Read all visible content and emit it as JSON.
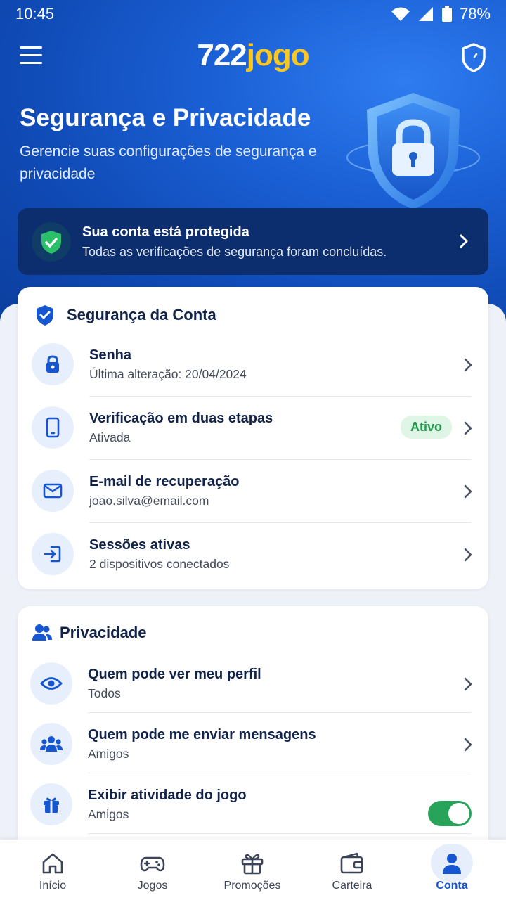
{
  "status_bar": {
    "time": "10:45",
    "battery": "78%"
  },
  "header": {
    "logo_number": "722",
    "logo_word": "jogo"
  },
  "hero": {
    "title": "Segurança e Privacidade",
    "subtitle": "Gerencie suas configurações de segurança e privacidade"
  },
  "protection": {
    "title": "Sua conta está protegida",
    "text": "Todas as verificações de segurança foram concluídas."
  },
  "security": {
    "title": "Segurança da Conta",
    "items": [
      {
        "title": "Senha",
        "subtitle": "Última alteração: 20/04/2024",
        "icon": "lock-icon"
      },
      {
        "title": "Verificação em duas etapas",
        "subtitle": "Ativada",
        "badge": "Ativo",
        "icon": "phone-icon"
      },
      {
        "title": "E-mail de recuperação",
        "subtitle": "joao.silva@email.com",
        "icon": "mail-icon"
      },
      {
        "title": "Sessões ativas",
        "subtitle": "2 dispositivos conectados",
        "icon": "login-icon"
      }
    ]
  },
  "privacy": {
    "title": "Privacidade",
    "items": [
      {
        "title": "Quem pode ver meu perfil",
        "subtitle": "Todos",
        "icon": "eye-icon"
      },
      {
        "title": "Quem pode me enviar mensagens",
        "subtitle": "Amigos",
        "icon": "group-icon"
      },
      {
        "title": "Exibir atividade do jogo",
        "subtitle": "Amigos",
        "icon": "gift-icon",
        "toggle_on": true
      }
    ]
  },
  "nav": {
    "items": [
      {
        "label": "Início",
        "icon": "home-icon"
      },
      {
        "label": "Jogos",
        "icon": "gamepad-icon"
      },
      {
        "label": "Promoções",
        "icon": "gift-icon"
      },
      {
        "label": "Carteira",
        "icon": "wallet-icon"
      },
      {
        "label": "Conta",
        "icon": "user-icon",
        "active": true
      }
    ]
  },
  "colors": {
    "primary": "#1656d0",
    "accent": "#f9c623",
    "success": "#28a35a",
    "dark_card": "#0d2e6e"
  }
}
